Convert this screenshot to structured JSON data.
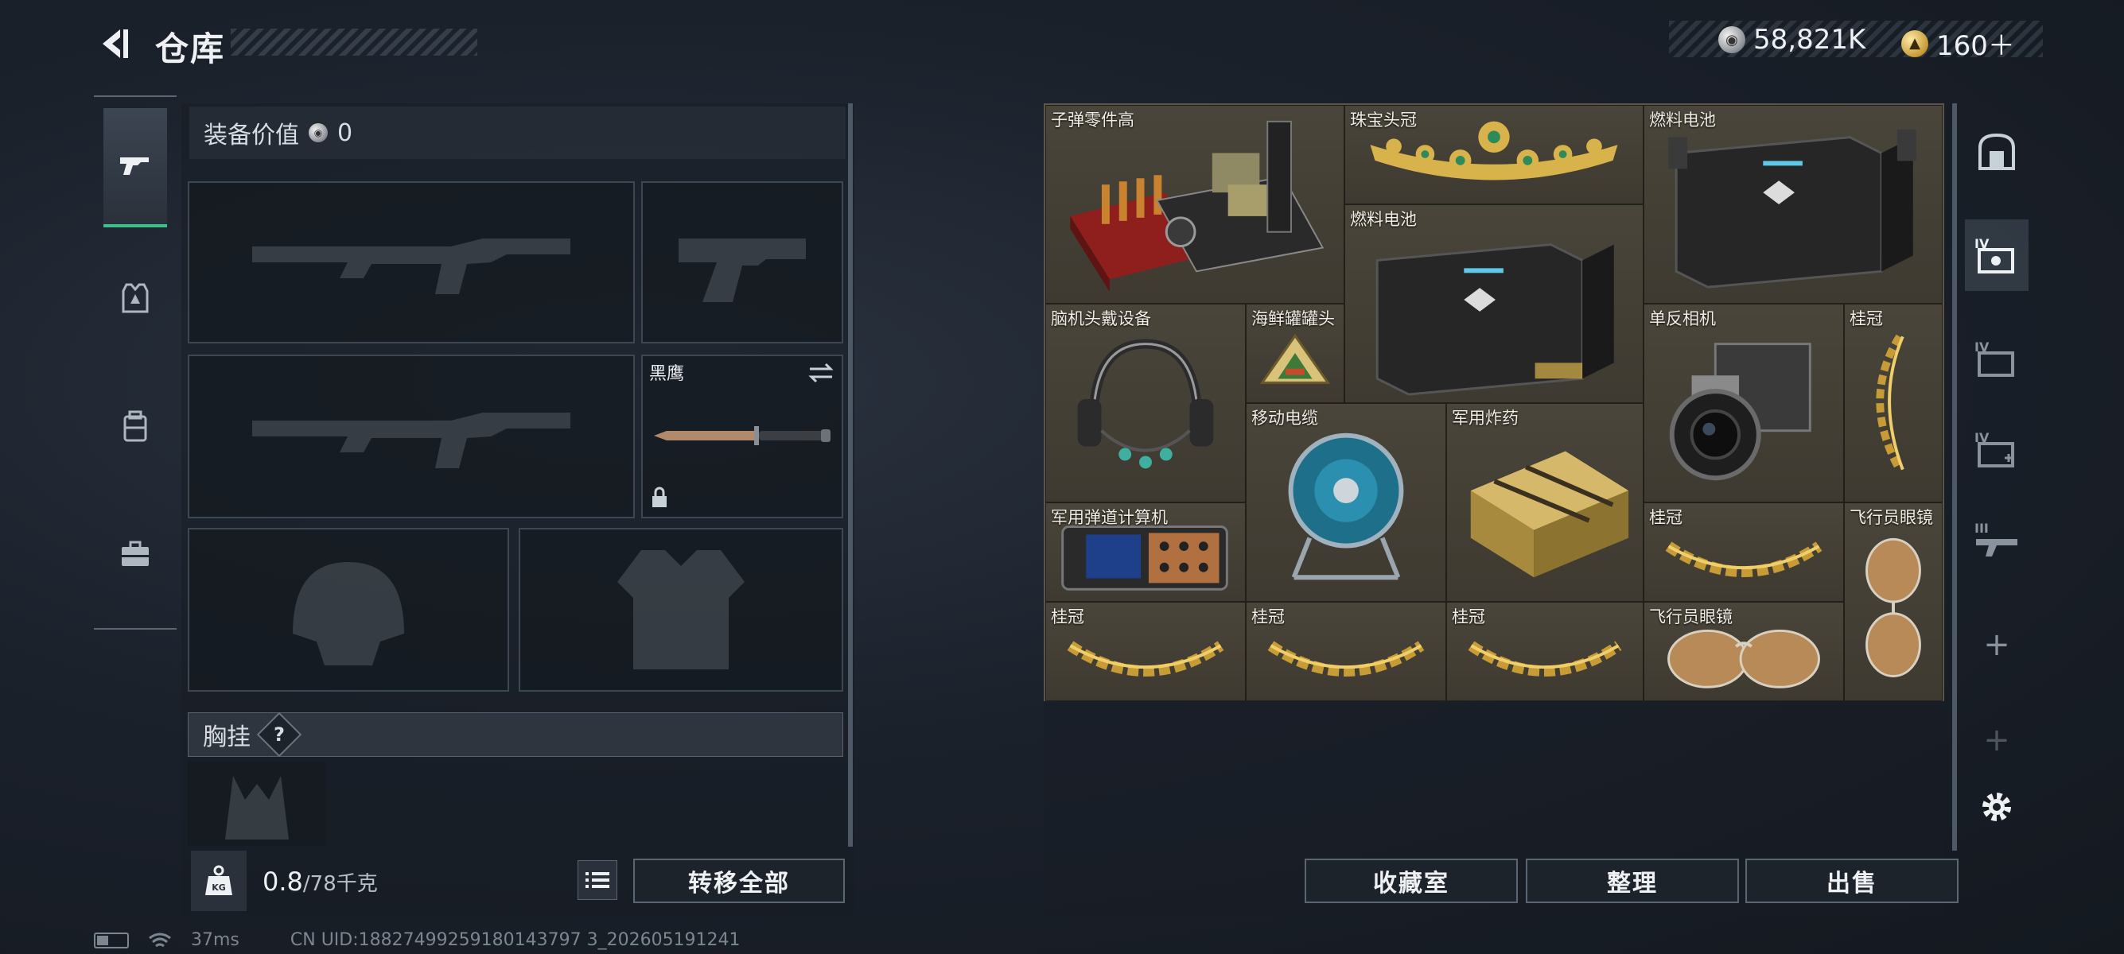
{
  "header": {
    "title": "仓库",
    "currency_silver": "58,821K",
    "currency_gold": "160＋"
  },
  "equipment": {
    "value_label": "装备价值",
    "value": "0",
    "knife_slot_label": "黑鹰",
    "chest_rig_label": "胸挂",
    "help_symbol": "?"
  },
  "footer_left": {
    "weight_current": "0.8",
    "weight_max": "/78千克",
    "transfer_all_label": "转移全部"
  },
  "storage_items": [
    {
      "name": "子弹零件高"
    },
    {
      "name": "珠宝头冠"
    },
    {
      "name": "燃料电池"
    },
    {
      "name": "燃料电池"
    },
    {
      "name": "脑机头戴设备"
    },
    {
      "name": "海鲜罐罐头"
    },
    {
      "name": "单反相机"
    },
    {
      "name": "桂冠"
    },
    {
      "name": "移动电缆"
    },
    {
      "name": "军用炸药"
    },
    {
      "name": "军用弹道计算机"
    },
    {
      "name": "桂冠"
    },
    {
      "name": "飞行员眼镜"
    },
    {
      "name": "桂冠"
    },
    {
      "name": "桂冠"
    },
    {
      "name": "桂冠"
    },
    {
      "name": "飞行员眼镜"
    }
  ],
  "footer_right": {
    "collection_label": "收藏室",
    "sort_label": "整理",
    "sell_label": "出售"
  },
  "right_rail": {
    "tab_labels": [
      "IV",
      "IV",
      "IV",
      "III"
    ],
    "add_symbol": "+"
  },
  "status_bar": {
    "ping": "37ms",
    "uid": "CN UID:18827499259180143797 3_202605191241"
  },
  "colors": {
    "accent_green": "#39c38b",
    "storage_bg": "#3d3931",
    "gold": "#c79b35"
  }
}
